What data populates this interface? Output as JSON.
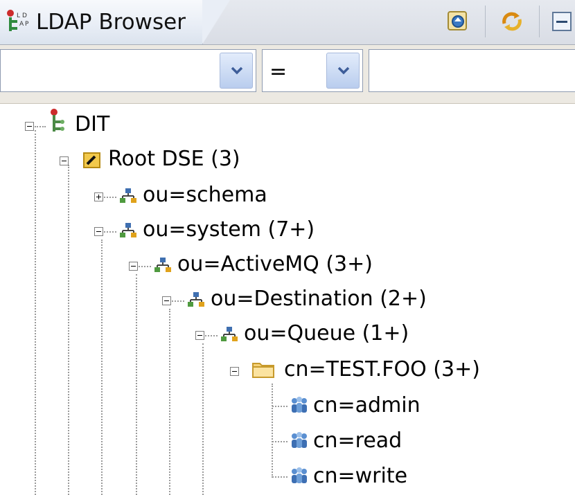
{
  "view": {
    "title": "LDAP Browser",
    "icons": [
      "ldap-browser-icon",
      "back-to-connection-icon",
      "refresh-icon",
      "collapse-all-icon"
    ]
  },
  "filter": {
    "attribute_value": "",
    "operator_value": "=",
    "filter_value": ""
  },
  "tree": {
    "nodes": [
      {
        "label": "DIT",
        "icon": "dit-icon",
        "expanded": true
      },
      {
        "label": "Root DSE (3)",
        "icon": "root-dse-icon",
        "expanded": true
      },
      {
        "label": "ou=schema",
        "icon": "organizational-unit-icon",
        "expanded": false
      },
      {
        "label": "ou=system (7+)",
        "icon": "organizational-unit-icon",
        "expanded": true
      },
      {
        "label": "ou=ActiveMQ (3+)",
        "icon": "organizational-unit-icon",
        "expanded": true
      },
      {
        "label": "ou=Destination (2+)",
        "icon": "organizational-unit-icon",
        "expanded": true
      },
      {
        "label": "ou=Queue (1+)",
        "icon": "organizational-unit-icon",
        "expanded": true
      },
      {
        "label": "cn=TEST.FOO (3+)",
        "icon": "folder-icon",
        "expanded": true
      },
      {
        "label": "cn=admin",
        "icon": "group-icon"
      },
      {
        "label": "cn=read",
        "icon": "group-icon"
      },
      {
        "label": "cn=write",
        "icon": "group-icon"
      }
    ]
  }
}
